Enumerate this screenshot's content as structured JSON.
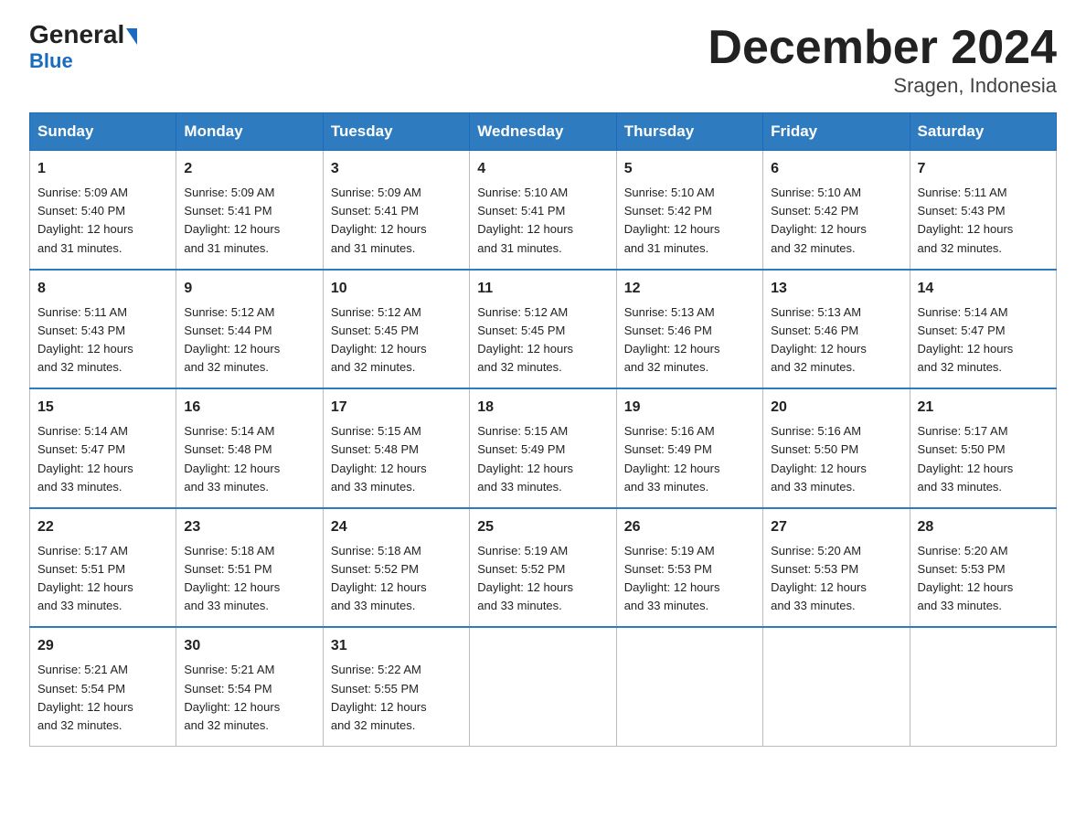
{
  "logo": {
    "general": "General",
    "blue": "Blue"
  },
  "header": {
    "month": "December 2024",
    "location": "Sragen, Indonesia"
  },
  "weekdays": [
    "Sunday",
    "Monday",
    "Tuesday",
    "Wednesday",
    "Thursday",
    "Friday",
    "Saturday"
  ],
  "weeks": [
    [
      {
        "day": "1",
        "sunrise": "5:09 AM",
        "sunset": "5:40 PM",
        "daylight": "12 hours and 31 minutes."
      },
      {
        "day": "2",
        "sunrise": "5:09 AM",
        "sunset": "5:41 PM",
        "daylight": "12 hours and 31 minutes."
      },
      {
        "day": "3",
        "sunrise": "5:09 AM",
        "sunset": "5:41 PM",
        "daylight": "12 hours and 31 minutes."
      },
      {
        "day": "4",
        "sunrise": "5:10 AM",
        "sunset": "5:41 PM",
        "daylight": "12 hours and 31 minutes."
      },
      {
        "day": "5",
        "sunrise": "5:10 AM",
        "sunset": "5:42 PM",
        "daylight": "12 hours and 31 minutes."
      },
      {
        "day": "6",
        "sunrise": "5:10 AM",
        "sunset": "5:42 PM",
        "daylight": "12 hours and 32 minutes."
      },
      {
        "day": "7",
        "sunrise": "5:11 AM",
        "sunset": "5:43 PM",
        "daylight": "12 hours and 32 minutes."
      }
    ],
    [
      {
        "day": "8",
        "sunrise": "5:11 AM",
        "sunset": "5:43 PM",
        "daylight": "12 hours and 32 minutes."
      },
      {
        "day": "9",
        "sunrise": "5:12 AM",
        "sunset": "5:44 PM",
        "daylight": "12 hours and 32 minutes."
      },
      {
        "day": "10",
        "sunrise": "5:12 AM",
        "sunset": "5:45 PM",
        "daylight": "12 hours and 32 minutes."
      },
      {
        "day": "11",
        "sunrise": "5:12 AM",
        "sunset": "5:45 PM",
        "daylight": "12 hours and 32 minutes."
      },
      {
        "day": "12",
        "sunrise": "5:13 AM",
        "sunset": "5:46 PM",
        "daylight": "12 hours and 32 minutes."
      },
      {
        "day": "13",
        "sunrise": "5:13 AM",
        "sunset": "5:46 PM",
        "daylight": "12 hours and 32 minutes."
      },
      {
        "day": "14",
        "sunrise": "5:14 AM",
        "sunset": "5:47 PM",
        "daylight": "12 hours and 32 minutes."
      }
    ],
    [
      {
        "day": "15",
        "sunrise": "5:14 AM",
        "sunset": "5:47 PM",
        "daylight": "12 hours and 33 minutes."
      },
      {
        "day": "16",
        "sunrise": "5:14 AM",
        "sunset": "5:48 PM",
        "daylight": "12 hours and 33 minutes."
      },
      {
        "day": "17",
        "sunrise": "5:15 AM",
        "sunset": "5:48 PM",
        "daylight": "12 hours and 33 minutes."
      },
      {
        "day": "18",
        "sunrise": "5:15 AM",
        "sunset": "5:49 PM",
        "daylight": "12 hours and 33 minutes."
      },
      {
        "day": "19",
        "sunrise": "5:16 AM",
        "sunset": "5:49 PM",
        "daylight": "12 hours and 33 minutes."
      },
      {
        "day": "20",
        "sunrise": "5:16 AM",
        "sunset": "5:50 PM",
        "daylight": "12 hours and 33 minutes."
      },
      {
        "day": "21",
        "sunrise": "5:17 AM",
        "sunset": "5:50 PM",
        "daylight": "12 hours and 33 minutes."
      }
    ],
    [
      {
        "day": "22",
        "sunrise": "5:17 AM",
        "sunset": "5:51 PM",
        "daylight": "12 hours and 33 minutes."
      },
      {
        "day": "23",
        "sunrise": "5:18 AM",
        "sunset": "5:51 PM",
        "daylight": "12 hours and 33 minutes."
      },
      {
        "day": "24",
        "sunrise": "5:18 AM",
        "sunset": "5:52 PM",
        "daylight": "12 hours and 33 minutes."
      },
      {
        "day": "25",
        "sunrise": "5:19 AM",
        "sunset": "5:52 PM",
        "daylight": "12 hours and 33 minutes."
      },
      {
        "day": "26",
        "sunrise": "5:19 AM",
        "sunset": "5:53 PM",
        "daylight": "12 hours and 33 minutes."
      },
      {
        "day": "27",
        "sunrise": "5:20 AM",
        "sunset": "5:53 PM",
        "daylight": "12 hours and 33 minutes."
      },
      {
        "day": "28",
        "sunrise": "5:20 AM",
        "sunset": "5:53 PM",
        "daylight": "12 hours and 33 minutes."
      }
    ],
    [
      {
        "day": "29",
        "sunrise": "5:21 AM",
        "sunset": "5:54 PM",
        "daylight": "12 hours and 32 minutes."
      },
      {
        "day": "30",
        "sunrise": "5:21 AM",
        "sunset": "5:54 PM",
        "daylight": "12 hours and 32 minutes."
      },
      {
        "day": "31",
        "sunrise": "5:22 AM",
        "sunset": "5:55 PM",
        "daylight": "12 hours and 32 minutes."
      },
      null,
      null,
      null,
      null
    ]
  ],
  "labels": {
    "sunrise": "Sunrise:",
    "sunset": "Sunset:",
    "daylight": "Daylight:"
  }
}
